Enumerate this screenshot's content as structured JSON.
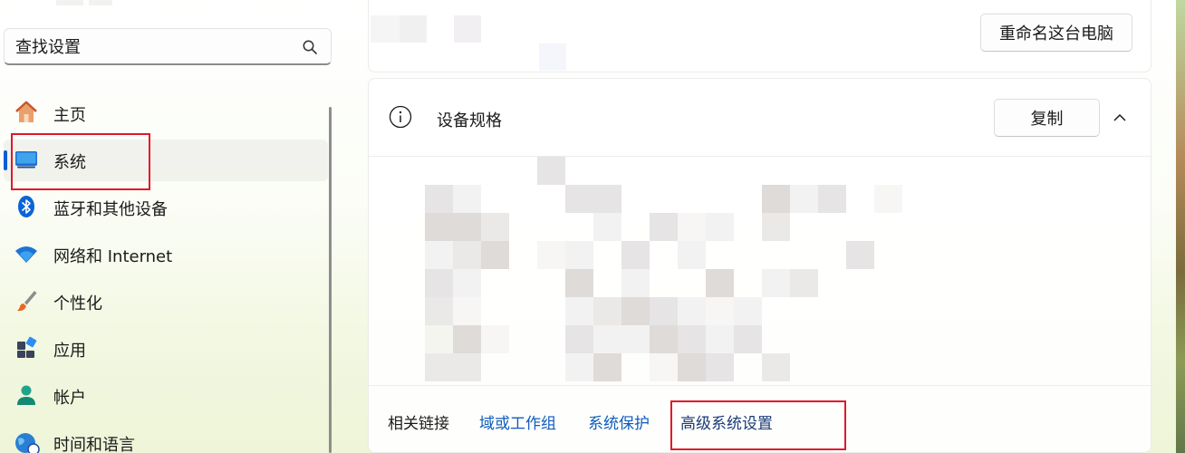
{
  "search": {
    "placeholder": "查找设置"
  },
  "sidebar": {
    "items": [
      {
        "label": "主页",
        "icon": "home-icon",
        "active": false
      },
      {
        "label": "系统",
        "icon": "system-display-icon",
        "active": true
      },
      {
        "label": "蓝牙和其他设备",
        "icon": "bluetooth-icon",
        "active": false
      },
      {
        "label": "网络和 Internet",
        "icon": "wifi-icon",
        "active": false
      },
      {
        "label": "个性化",
        "icon": "paintbrush-icon",
        "active": false
      },
      {
        "label": "应用",
        "icon": "apps-icon",
        "active": false
      },
      {
        "label": "帐户",
        "icon": "account-icon",
        "active": false
      },
      {
        "label": "时间和语言",
        "icon": "globe-clock-icon",
        "active": false
      }
    ]
  },
  "main": {
    "rename_button": "重命名这台电脑",
    "spec": {
      "title": "设备规格",
      "copy_button": "复制",
      "expanded": true
    },
    "related": {
      "label": "相关链接",
      "links": [
        "域或工作组",
        "系统保护",
        "高级系统设置"
      ]
    }
  },
  "colors": {
    "accent": "#0b5cd5",
    "link": "#0f5bbd",
    "highlight": "#e2162a"
  }
}
